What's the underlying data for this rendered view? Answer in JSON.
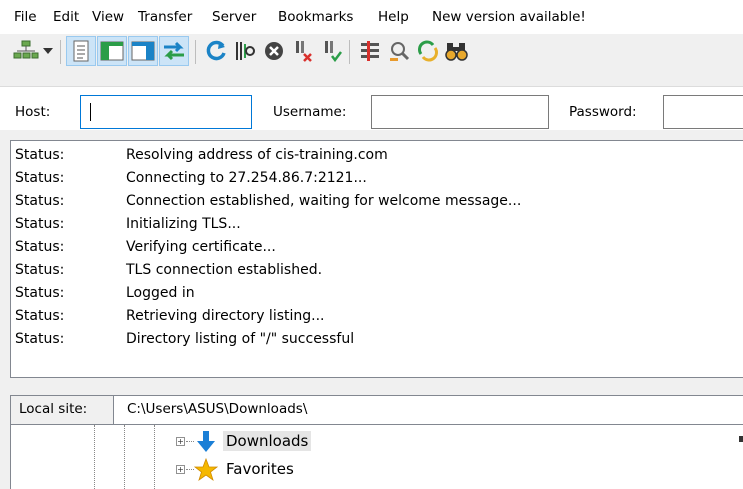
{
  "menu": {
    "items": [
      "File",
      "Edit",
      "View",
      "Transfer",
      "Server",
      "Bookmarks",
      "Help",
      "New version available!"
    ]
  },
  "toolbar": {
    "buttons": [
      "site-manager-icon",
      "dropdown-arrow-icon",
      "toggle-message-log-icon",
      "toggle-local-tree-icon",
      "toggle-remote-tree-icon",
      "toggle-transfer-queue-icon",
      "refresh-icon",
      "process-queue-icon",
      "cancel-operation-icon",
      "disconnect-icon",
      "reconnect-icon",
      "directory-listing-filters-icon",
      "toggle-directory-comparison-icon",
      "synchronized-browsing-icon",
      "search-remote-files-icon"
    ]
  },
  "quickconnect": {
    "host_label": "Host:",
    "host_value": "",
    "username_label": "Username:",
    "username_value": "",
    "password_label": "Password:",
    "password_value": ""
  },
  "log": {
    "rows": [
      {
        "kind": "Status:",
        "message": "Resolving address of cis-training.com"
      },
      {
        "kind": "Status:",
        "message": "Connecting to 27.254.86.7:2121..."
      },
      {
        "kind": "Status:",
        "message": "Connection established, waiting for welcome message..."
      },
      {
        "kind": "Status:",
        "message": "Initializing TLS..."
      },
      {
        "kind": "Status:",
        "message": "Verifying certificate..."
      },
      {
        "kind": "Status:",
        "message": "TLS connection established."
      },
      {
        "kind": "Status:",
        "message": "Logged in"
      },
      {
        "kind": "Status:",
        "message": "Retrieving directory listing..."
      },
      {
        "kind": "Status:",
        "message": "Directory listing of \"/\" successful"
      }
    ]
  },
  "local_site": {
    "label": "Local site:",
    "path": "C:\\Users\\ASUS\\Downloads\\",
    "tree": [
      {
        "label": "Downloads",
        "icon": "download-arrow-icon",
        "selected": true
      },
      {
        "label": "Favorites",
        "icon": "star-icon",
        "selected": false
      }
    ]
  },
  "colors": {
    "selection_bg": "#e5e5e5",
    "pressed_button_bg": "#cce4f7",
    "focus_border": "#0078d7"
  }
}
